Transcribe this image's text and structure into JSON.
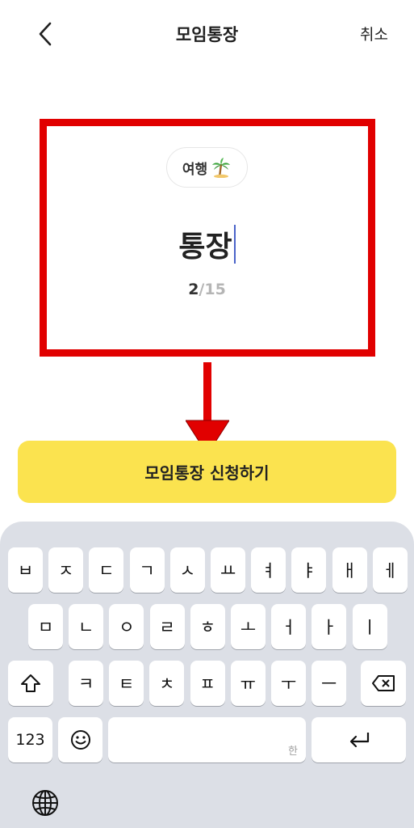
{
  "header": {
    "back_icon": "chevron-left-icon",
    "title": "모임통장",
    "cancel_label": "취소"
  },
  "account": {
    "tag_label": "여행",
    "tag_icon": "palm-tree-icon",
    "name_value": "통장",
    "char_count": "2",
    "char_max": "/15"
  },
  "submit": {
    "label": "모임통장 신청하기"
  },
  "keyboard": {
    "row1": [
      "ㅂ",
      "ㅈ",
      "ㄷ",
      "ㄱ",
      "ㅅ",
      "ㅛ",
      "ㅕ",
      "ㅑ",
      "ㅐ",
      "ㅔ"
    ],
    "row2": [
      "ㅁ",
      "ㄴ",
      "ㅇ",
      "ㄹ",
      "ㅎ",
      "ㅗ",
      "ㅓ",
      "ㅏ",
      "ㅣ"
    ],
    "row3": [
      "ㅋ",
      "ㅌ",
      "ㅊ",
      "ㅍ",
      "ㅠ",
      "ㅜ",
      "ㅡ"
    ],
    "numbers_label": "123",
    "space_hint": "한",
    "shift_icon": "shift-icon",
    "backspace_icon": "backspace-icon",
    "emoji_icon": "emoji-icon",
    "return_icon": "return-icon",
    "globe_icon": "globe-icon"
  },
  "colors": {
    "accent_yellow": "#fbe34f",
    "annotation_red": "#e10000",
    "caret_blue": "#4a63c9",
    "keyboard_bg": "#dcdfe6"
  }
}
